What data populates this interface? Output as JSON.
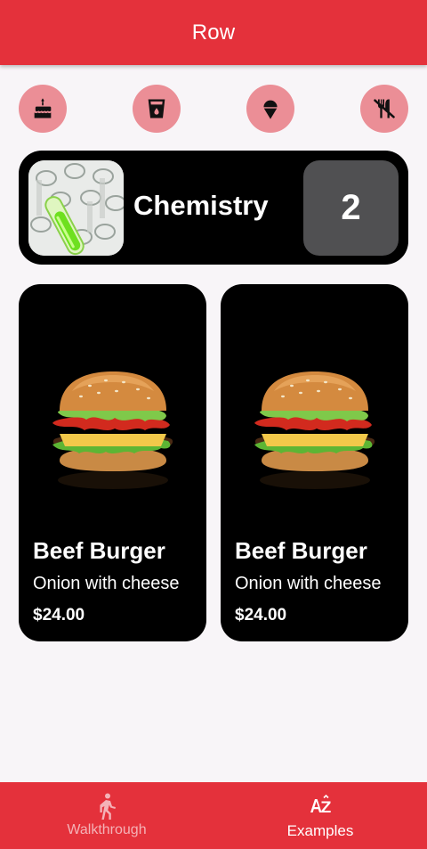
{
  "app_bar": {
    "title": "Row"
  },
  "categories": [
    {
      "icon": "cake-icon"
    },
    {
      "icon": "drink-cup-icon"
    },
    {
      "icon": "ice-cream-icon"
    },
    {
      "icon": "no-food-icon"
    }
  ],
  "info_card": {
    "title": "Chemistry",
    "count": "2",
    "thumbnail": "test-tubes-photo"
  },
  "products": [
    {
      "name": "Beef Burger",
      "description": "Onion with cheese",
      "price": "$24.00",
      "image": "burger-photo"
    },
    {
      "name": "Beef Burger",
      "description": "Onion with cheese",
      "price": "$24.00",
      "image": "burger-photo"
    }
  ],
  "bottom_nav": {
    "items": [
      {
        "label": "Walkthrough",
        "icon": "walking-person-icon",
        "active": false
      },
      {
        "label": "Examples",
        "icon": "sort-az-icon",
        "active": true
      }
    ]
  },
  "colors": {
    "primary": "#e4313b",
    "category_bg": "#eb8e96",
    "card_bg": "#000000",
    "count_bg": "#505052",
    "page_bg": "#f8f5f8"
  }
}
